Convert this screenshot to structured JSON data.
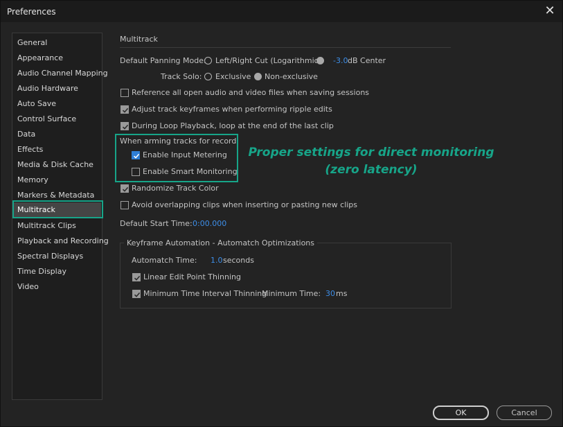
{
  "window": {
    "title": "Preferences"
  },
  "sidebar": {
    "items": [
      {
        "label": "General"
      },
      {
        "label": "Appearance"
      },
      {
        "label": "Audio Channel Mapping"
      },
      {
        "label": "Audio Hardware"
      },
      {
        "label": "Auto Save"
      },
      {
        "label": "Control Surface"
      },
      {
        "label": "Data"
      },
      {
        "label": "Effects"
      },
      {
        "label": "Media & Disk Cache"
      },
      {
        "label": "Memory"
      },
      {
        "label": "Markers & Metadata"
      },
      {
        "label": "Multitrack",
        "selected": true
      },
      {
        "label": "Multitrack Clips"
      },
      {
        "label": "Playback and Recording"
      },
      {
        "label": "Spectral Displays"
      },
      {
        "label": "Time Display"
      },
      {
        "label": "Video"
      }
    ]
  },
  "main": {
    "section_title": "Multitrack",
    "panning": {
      "label": "Default Panning Mode:",
      "option1": "Left/Right Cut (Logarithmic)",
      "value": "-3.0",
      "option2_suffix": "dB Center"
    },
    "solo": {
      "label": "Track Solo:",
      "option1": "Exclusive",
      "option2": "Non-exclusive"
    },
    "checks": {
      "reference": {
        "label": "Reference all open audio and video files when saving sessions",
        "checked": false
      },
      "adjust": {
        "label": "Adjust track keyframes when performing ripple edits",
        "checked": true
      },
      "loop": {
        "label": "During Loop Playback, loop at the end of the last clip",
        "checked": true
      },
      "randomize": {
        "label": "Randomize Track Color",
        "checked": true
      },
      "avoid": {
        "label": "Avoid overlapping clips when inserting or pasting new clips",
        "checked": false
      }
    },
    "arming": {
      "label": "When arming tracks for record",
      "input_metering": {
        "label": "Enable Input Metering",
        "checked": true
      },
      "smart_monitoring": {
        "label": "Enable Smart Monitoring",
        "checked": false
      }
    },
    "start_time": {
      "label": "Default Start Time:",
      "value": "0:00.000"
    },
    "keyframe": {
      "title": "Keyframe Automation - Automatch Optimizations",
      "automatch_label": "Automatch Time:",
      "automatch_value": "1.0",
      "automatch_unit": "seconds",
      "linear": {
        "label": "Linear Edit Point Thinning",
        "checked": true
      },
      "minimum": {
        "label": "Minimum Time Interval Thinning",
        "checked": true
      },
      "min_time_label": "Minimum Time:",
      "min_time_value": "30",
      "min_time_unit": "ms"
    }
  },
  "annotation": {
    "line1": "Proper settings for direct monitoring",
    "line2": "(zero latency)"
  },
  "buttons": {
    "ok": "OK",
    "cancel": "Cancel"
  },
  "colors": {
    "accent_highlight": "#17a589",
    "value_blue": "#3d8ee8",
    "checkbox_blue": "#2f7fd6"
  }
}
